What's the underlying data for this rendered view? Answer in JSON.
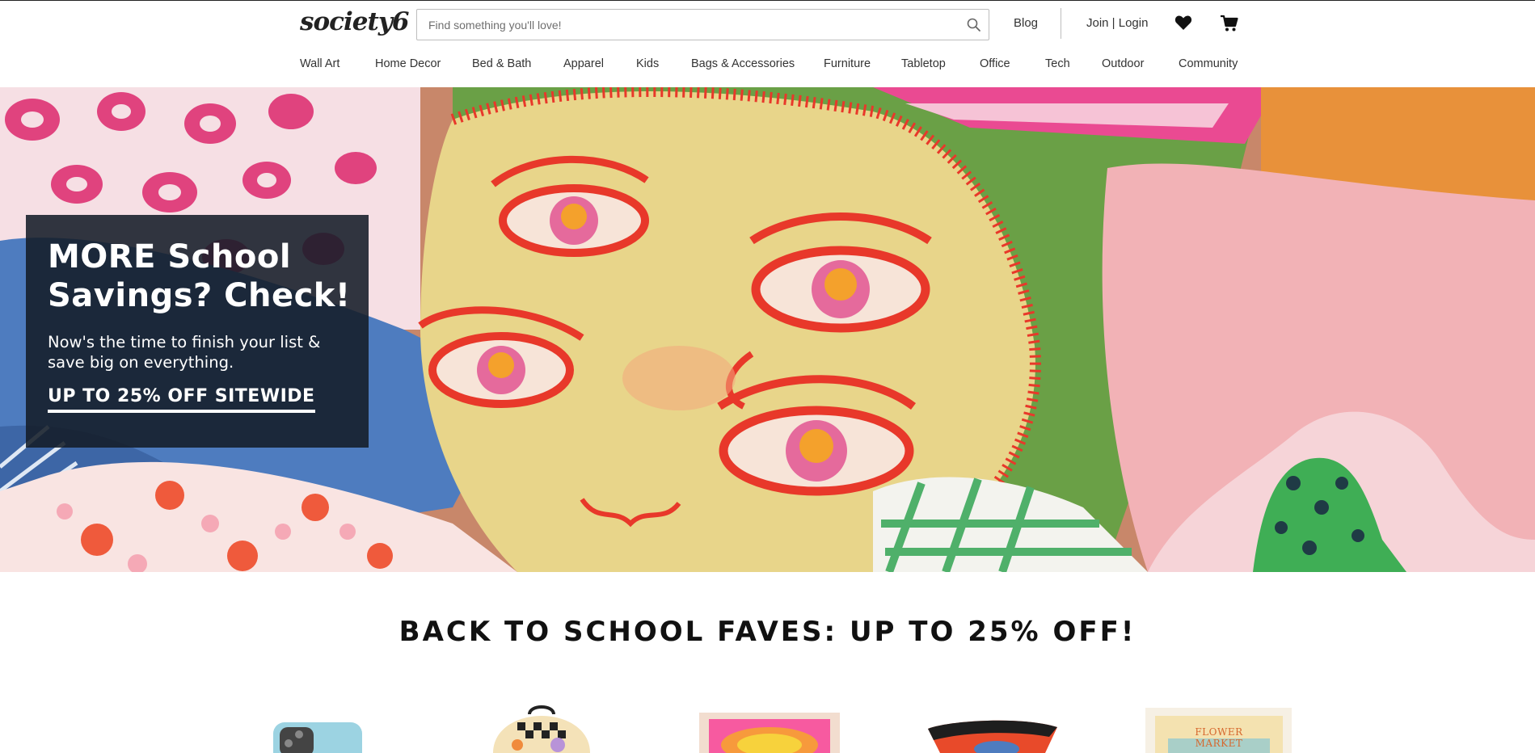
{
  "header": {
    "logo": "society6",
    "search_placeholder": "Find something you'll love!",
    "blog_label": "Blog",
    "login_label": "Join | Login",
    "icons": [
      "search-icon",
      "heart-icon",
      "cart-icon"
    ]
  },
  "nav": {
    "items": [
      "Wall Art",
      "Home Decor",
      "Bed & Bath",
      "Apparel",
      "Kids",
      "Bags & Accessories",
      "Furniture",
      "Tabletop",
      "Office",
      "Tech",
      "Outdoor",
      "Community"
    ]
  },
  "hero": {
    "title": "MORE School Savings? Check!",
    "subtitle": "Now's the time to finish your list & save big on everything.",
    "cta": "UP TO 25% OFF SITEWIDE"
  },
  "section": {
    "title": "BACK TO SCHOOL FAVES: UP TO 25% OFF!"
  },
  "products": {
    "items": [
      "Phone Case",
      "Backpack",
      "Art Print",
      "Mug",
      "Poster"
    ],
    "poster_text": "FLOWER MARKET"
  },
  "colors": {
    "promo_bg": "#141c28",
    "text_dark": "#222222",
    "pillow_yellow": "#e8d58a",
    "pillow_red": "#e8382a",
    "pillow_pink": "#f2b2b6",
    "pillow_green": "#6aa046",
    "pillow_orange": "#e8913a",
    "denim_blue": "#4e7cbf"
  }
}
